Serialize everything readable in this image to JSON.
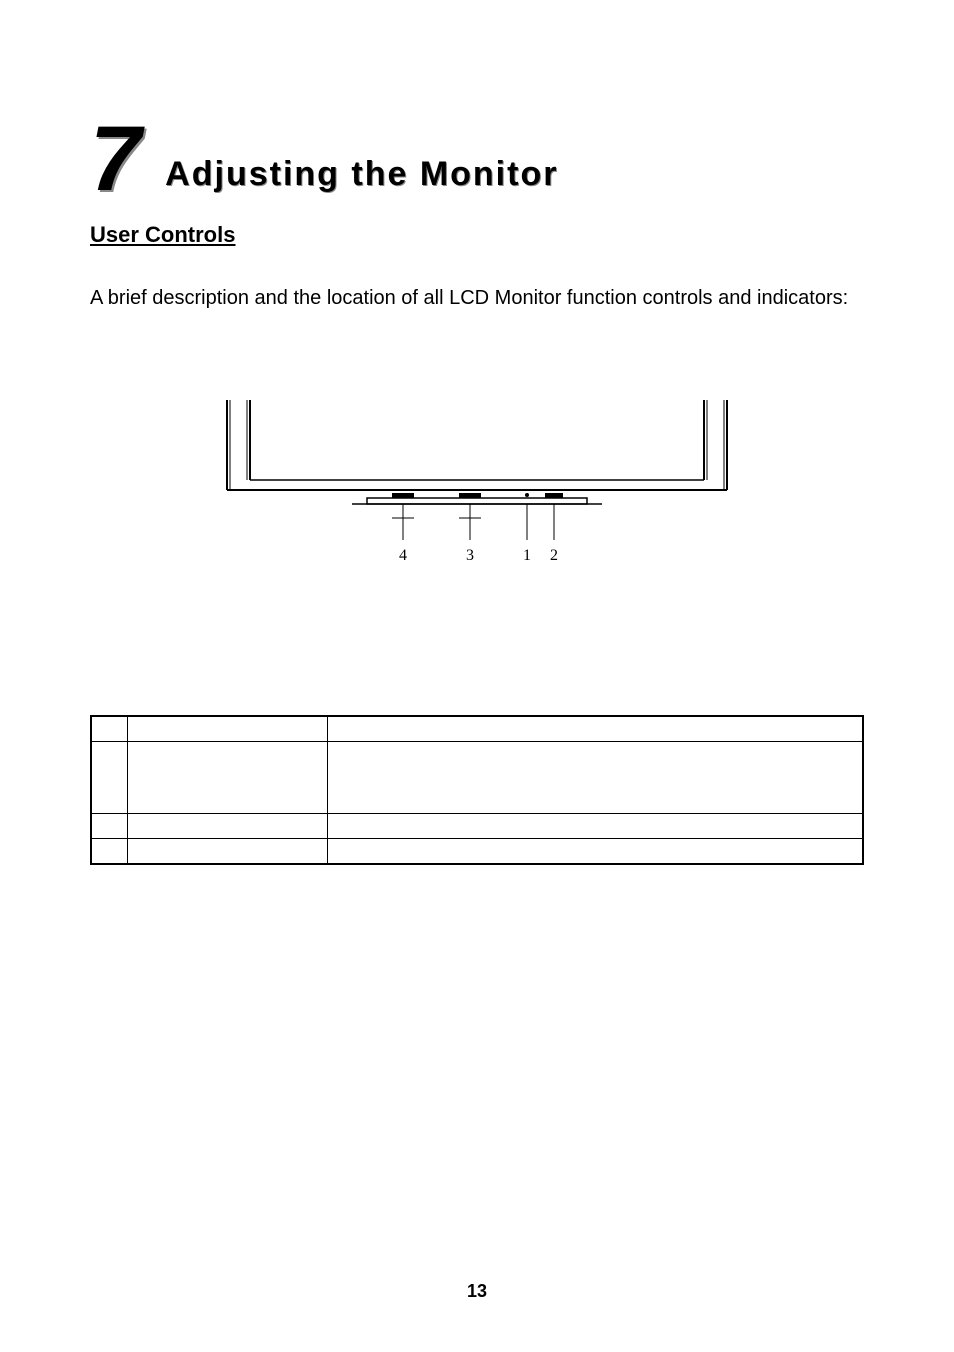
{
  "chapter": {
    "number": "7",
    "title": "Adjusting the Monitor"
  },
  "section_header": "User Controls",
  "intro": "A brief description and the location of all LCD Monitor function controls and indicators:",
  "diagram": {
    "labels": {
      "a": "4",
      "b": "3",
      "c": "1",
      "d": "2"
    }
  },
  "table": {
    "rows": [
      {
        "num": "",
        "label": "",
        "desc": ""
      },
      {
        "num": "",
        "label": "",
        "desc": ""
      },
      {
        "num": "",
        "label": "",
        "desc": ""
      },
      {
        "num": "",
        "label": "",
        "desc": ""
      }
    ]
  },
  "page_number": "13"
}
